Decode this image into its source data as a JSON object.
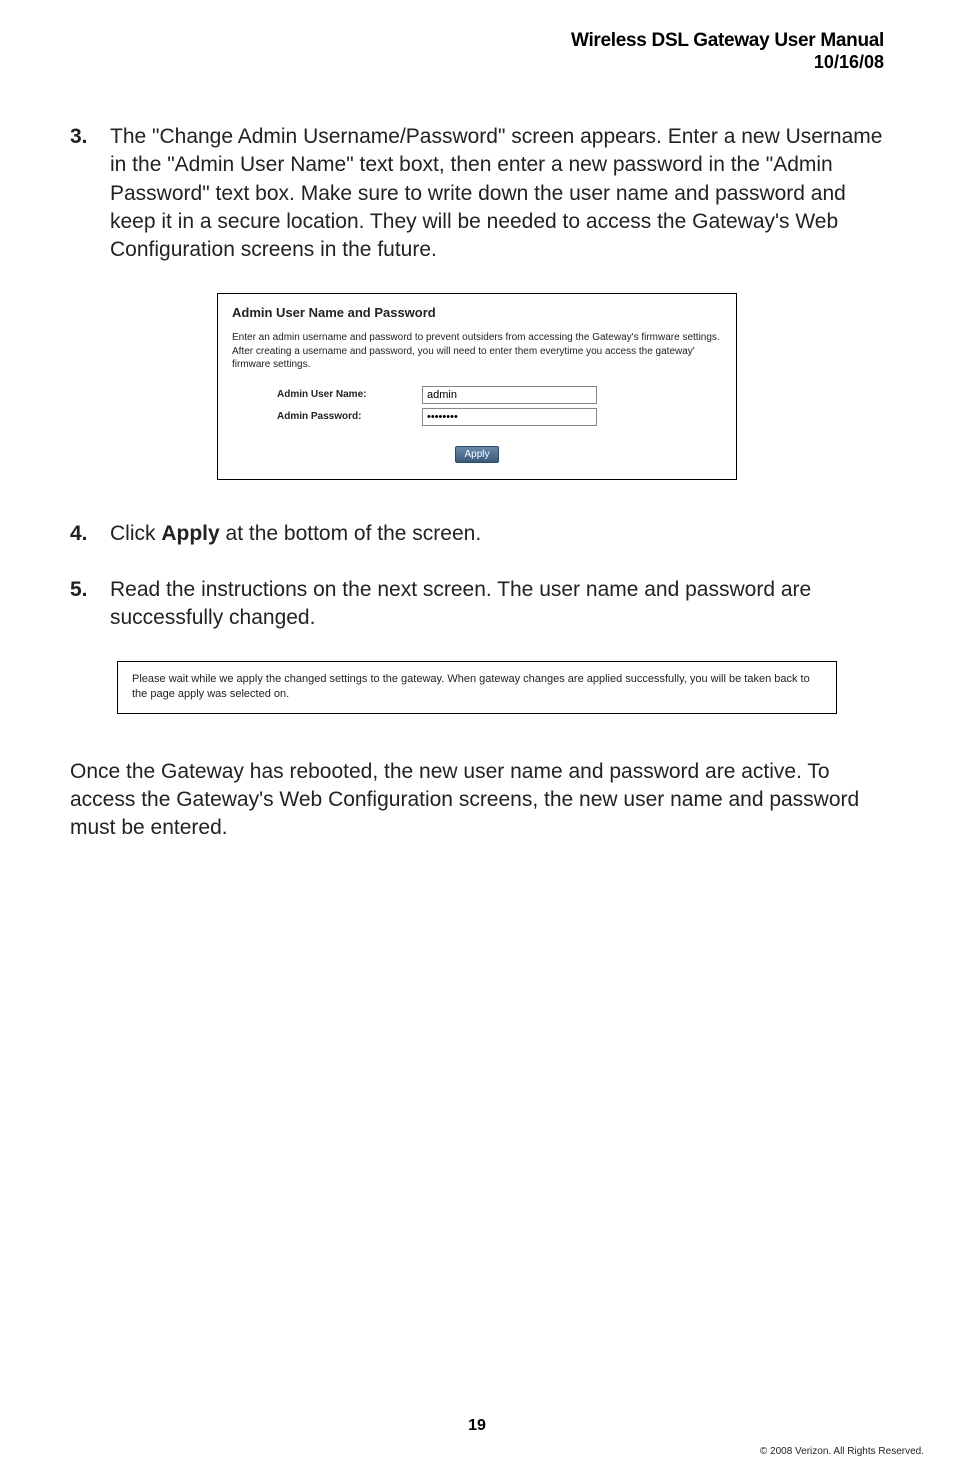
{
  "header": {
    "title": "Wireless DSL Gateway User Manual",
    "date": "10/16/08"
  },
  "items": {
    "item3": {
      "num": "3.",
      "text": "The \"Change Admin Username/Password\" screen appears. Enter a new Username in the \"Admin User Name\" text boxt, then enter a new password in the \"Admin Password\" text box. Make sure to write down the user name and password and keep it in a secure location. They will be needed to access the Gateway's Web Configuration screens in the future."
    },
    "item4": {
      "num": "4.",
      "prefix": "Click ",
      "bold": "Apply",
      "suffix": " at the bottom of the screen."
    },
    "item5": {
      "num": "5.",
      "text": "Read the instructions on the next screen. The user name and password are successfully changed."
    }
  },
  "dialog1": {
    "title": "Admin User Name and Password",
    "desc": "Enter an admin username and password to prevent outsiders from accessing the Gateway's firmware settings. After creating a username and password, you will need to enter them everytime you access the gateway' firmware settings.",
    "username_label": "Admin User Name:",
    "username_value": "admin",
    "password_label": "Admin Password:",
    "password_value": "••••••••",
    "apply": "Apply"
  },
  "dialog2": {
    "text": "Please wait while we apply the changed settings to the gateway. When gateway changes are applied successfully, you will be taken back to the page apply was selected on."
  },
  "closing": "Once the Gateway has rebooted, the new user name and password are active. To access the Gateway's Web Configuration screens, the new user name and password must be entered.",
  "page_number": "19",
  "copyright": "© 2008 Verizon. All Rights Reserved."
}
